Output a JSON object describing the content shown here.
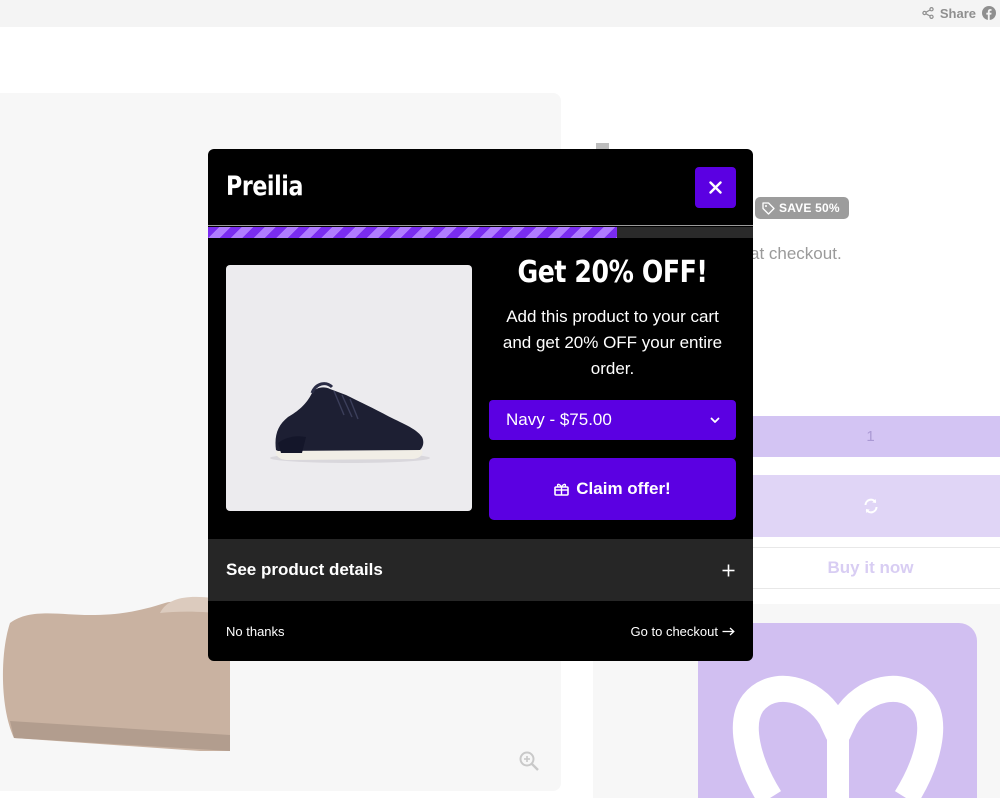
{
  "page": {
    "share_label": "Share",
    "save_badge": "SAVE 50%",
    "checkout_note": "at checkout.",
    "quantity": "1",
    "buy_now_label": "Buy it now"
  },
  "modal": {
    "brand": "Preilia",
    "progress_fraction": 0.75,
    "offer_title": "Get 20% OFF!",
    "offer_description": "Add this product to your cart and get 20% OFF your entire order.",
    "variant_selected": "Navy - $75.00",
    "claim_label": "Claim offer!",
    "details_label": "See product details",
    "no_thanks_label": "No thanks",
    "checkout_label": "Go to checkout",
    "accent_color": "#5b00e2"
  },
  "icons": [
    "share-icon",
    "facebook-icon",
    "tag-icon",
    "zoom-in-icon",
    "refresh-icon",
    "close-icon",
    "chevron-down-icon",
    "gift-icon",
    "plus-icon",
    "arrow-right-icon",
    "butterfly-logo-icon"
  ]
}
